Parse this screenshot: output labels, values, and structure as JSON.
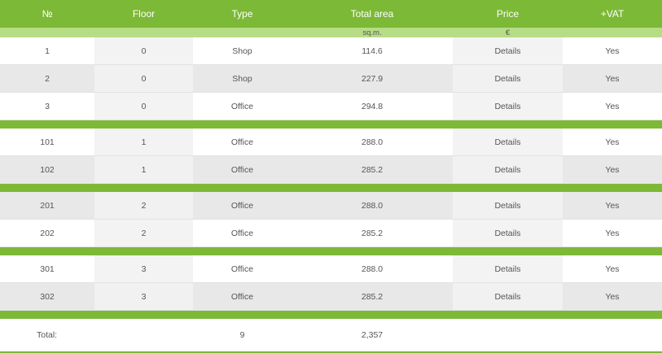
{
  "table": {
    "headers": [
      "№",
      "Floor",
      "Type",
      "Total area",
      "Price",
      "+VAT"
    ],
    "units_row": [
      "",
      "",
      "",
      "sq.m.",
      "€",
      ""
    ],
    "groups": [
      [
        {
          "no": "1",
          "floor": "0",
          "type": "Shop",
          "area": "114.6",
          "price": "Details",
          "vat": "Yes",
          "shade": "white"
        },
        {
          "no": "2",
          "floor": "0",
          "type": "Shop",
          "area": "227.9",
          "price": "Details",
          "vat": "Yes",
          "shade": "grey"
        },
        {
          "no": "3",
          "floor": "0",
          "type": "Office",
          "area": "294.8",
          "price": "Details",
          "vat": "Yes",
          "shade": "white"
        }
      ],
      [
        {
          "no": "101",
          "floor": "1",
          "type": "Office",
          "area": "288.0",
          "price": "Details",
          "vat": "Yes",
          "shade": "white"
        },
        {
          "no": "102",
          "floor": "1",
          "type": "Office",
          "area": "285.2",
          "price": "Details",
          "vat": "Yes",
          "shade": "grey"
        }
      ],
      [
        {
          "no": "201",
          "floor": "2",
          "type": "Office",
          "area": "288.0",
          "price": "Details",
          "vat": "Yes",
          "shade": "grey"
        },
        {
          "no": "202",
          "floor": "2",
          "type": "Office",
          "area": "285.2",
          "price": "Details",
          "vat": "Yes",
          "shade": "white"
        }
      ],
      [
        {
          "no": "301",
          "floor": "3",
          "type": "Office",
          "area": "288.0",
          "price": "Details",
          "vat": "Yes",
          "shade": "white"
        },
        {
          "no": "302",
          "floor": "3",
          "type": "Office",
          "area": "285.2",
          "price": "Details",
          "vat": "Yes",
          "shade": "grey"
        }
      ]
    ],
    "total": {
      "label": "Total:",
      "count": "9",
      "area": "2,357"
    }
  },
  "colors": {
    "header_green": "#7cb936",
    "units_row_green": "#b6dc85"
  }
}
